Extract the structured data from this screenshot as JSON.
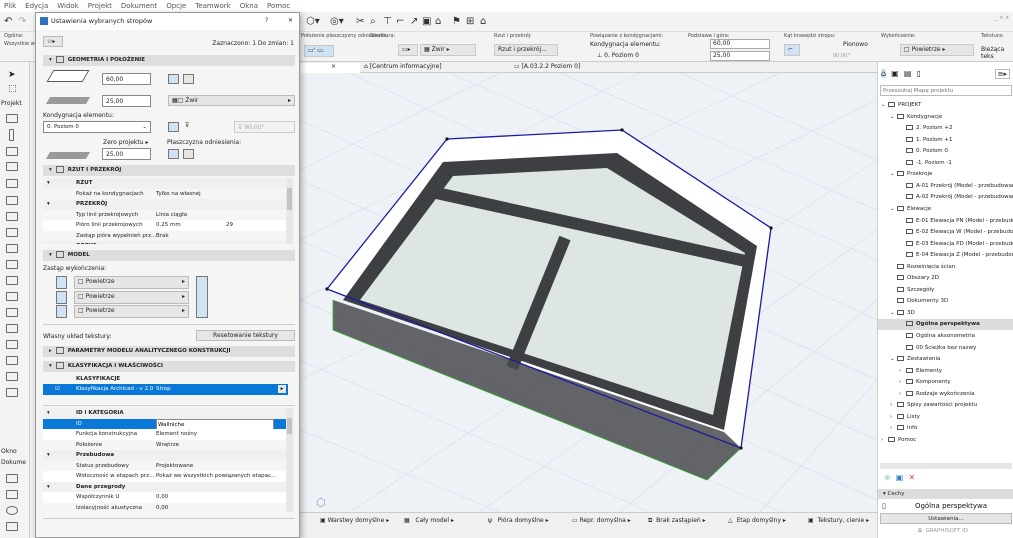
{
  "menu": [
    "Plik",
    "Edycja",
    "Widok",
    "Projekt",
    "Dokument",
    "Opcje",
    "Teamwork",
    "Okna",
    "Pomoc"
  ],
  "infobox": {
    "ogolne": "Ogólne:",
    "wszystkie": "Wszystkie wyb",
    "plaszczyzna_label": "Położenie płaszczyzny odniesienia:",
    "struktura_label": "Struktura:",
    "struktura_value": "Żwir",
    "rzut_label": "Rzut i przekrój:",
    "rzut_value": "Rzut i przekrój...",
    "powiazanie_label": "Powiązanie z kondygnacjami:",
    "kondygnacja_label": "Kondygnacja elementu:",
    "kondygnacja_value": "0. Poziom 0",
    "podstawa_label": "Podstawa i góra:",
    "top_value": "60,00",
    "bottom_value": "25,00",
    "kat_label": "Kąt krawędzi stropu:",
    "pionowo": "Pionowo",
    "angle": "90,00°",
    "wykonczenie_label": "Wykończenie:",
    "wykonczenie_value": "Powietrze",
    "tekstura_label": "Tekstura:",
    "tekstura_value": "Bieżąca teks"
  },
  "tabs": [
    "[Centrum informacyjne]",
    "[A.03.2.2 Poziom 0]"
  ],
  "toolbox": {
    "projekt": "Projekt",
    "okno": "Okno",
    "dokument": "Dokume"
  },
  "statusbar": [
    "Warstwy domyślne",
    "Cały model",
    "Pióra domyślne",
    "Repr. domyślna",
    "Brak zastąpień",
    "Etap domyślny",
    "Tekstury, cienie"
  ],
  "dialog": {
    "title": "Ustawienia wybranych stropów",
    "help": "?",
    "close": "✕",
    "selected": "Zaznaczono: 1 Do zmian: 1",
    "geometry": {
      "header": "GEOMETRIA I POŁOŻENIE",
      "thickness": "60,00",
      "offset": "25,00",
      "structure": "Żwir",
      "story_label": "Kondygnacja elementu:",
      "story": "0. Poziom 0",
      "zero_label": "Zero projektu",
      "zero_value": "25,00",
      "angle": "90,00°",
      "ref_label": "Płaszczyzna odniesienia:"
    },
    "plan": {
      "header": "RZUT I PRZEKRÓJ",
      "rows": [
        {
          "type": "group",
          "k": "RZUT"
        },
        {
          "k": "Pokaż na kondygnacjach",
          "v": "Tylko na własnej"
        },
        {
          "type": "group",
          "k": "PRZEKRÓJ"
        },
        {
          "k": "Typ linii przekrojowych",
          "v": "Linia ciągła"
        },
        {
          "k": "Pióro linii przekrojowych",
          "v": "0.25 mm",
          "n": "29"
        },
        {
          "k": "Zastąp pióra wypełnień prz...",
          "v": "Brak"
        },
        {
          "type": "group",
          "k": "OBRYS"
        }
      ]
    },
    "model": {
      "header": "MODEL",
      "override_label": "Zastąp wykończenia:",
      "surfaces": [
        "Powietrze",
        "Powietrze",
        "Powietrze"
      ],
      "texture_label": "Własny układ tekstury:",
      "reset_button": "Resetowanie tekstury"
    },
    "analytic": {
      "header": "PARAMETRY MODELU ANALITYCZNEGO KONSTRUKCJI"
    },
    "classification": {
      "header": "KLASYFIKACJA I WŁAŚCIWOŚCI",
      "group": "KLASYFIKACJE",
      "system": "Klasyfikacja Archicad - v 2.0",
      "value": "Strop"
    },
    "properties": [
      {
        "type": "group",
        "k": "ID i KATEGORIA"
      },
      {
        "k": "ID",
        "v": "Wallniche",
        "selected": true
      },
      {
        "k": "Funkcja konstrukcyjna",
        "v": "Element nośny"
      },
      {
        "k": "Położenie",
        "v": "Wnętrze"
      },
      {
        "type": "group",
        "k": "Przebudowa"
      },
      {
        "k": "Status przebudowy",
        "v": "Projektowane"
      },
      {
        "k": "Widoczność w etapach prz...",
        "v": "Pokaż we wszystkich powiązanych etapac..."
      },
      {
        "type": "group",
        "k": "Dane przegrody"
      },
      {
        "k": "Współczynnik U",
        "v": "0,00"
      },
      {
        "k": "Izolacyjność akustyczna",
        "v": "0,00"
      }
    ]
  },
  "navigator": {
    "search_placeholder": "Przeszukaj Mapę projektu",
    "tree": [
      {
        "l": 0,
        "t": "PROJEKT",
        "exp": "v"
      },
      {
        "l": 1,
        "t": "Kondygnacje",
        "exp": "v"
      },
      {
        "l": 2,
        "t": "2. Poziom +2"
      },
      {
        "l": 2,
        "t": "1. Poziom +1"
      },
      {
        "l": 2,
        "t": "0. Poziom 0"
      },
      {
        "l": 2,
        "t": "-1. Poziom -1"
      },
      {
        "l": 1,
        "t": "Przekroje",
        "exp": "v"
      },
      {
        "l": 2,
        "t": "A-01 Przekrój (Model - przebudowanie)"
      },
      {
        "l": 2,
        "t": "A-02 Przekrój (Model - przebudowanie)"
      },
      {
        "l": 1,
        "t": "Elewacje",
        "exp": "v"
      },
      {
        "l": 2,
        "t": "E-01 Elewacja PN (Model - przebudowanie)"
      },
      {
        "l": 2,
        "t": "E-02 Elewacja W (Model - przebudowanie)"
      },
      {
        "l": 2,
        "t": "E-03 Elewacja PD (Model - przebudowanie)"
      },
      {
        "l": 2,
        "t": "E-04 Elewacja Z (Model - przebudowanie)"
      },
      {
        "l": 1,
        "t": "Rozwinięcia ścian"
      },
      {
        "l": 1,
        "t": "Obszary 2D"
      },
      {
        "l": 1,
        "t": "Szczegóły"
      },
      {
        "l": 1,
        "t": "Dokumenty 3D"
      },
      {
        "l": 1,
        "t": "3D",
        "exp": "v"
      },
      {
        "l": 2,
        "t": "Ogólna perspektywa",
        "sel": true
      },
      {
        "l": 2,
        "t": "Ogólna aksonometria"
      },
      {
        "l": 2,
        "t": "00 Ścieżka bez nazwy"
      },
      {
        "l": 1,
        "t": "Zestawienia",
        "exp": "v"
      },
      {
        "l": 2,
        "t": "Elementy",
        "exp": ">"
      },
      {
        "l": 2,
        "t": "Komponenty",
        "exp": ">"
      },
      {
        "l": 2,
        "t": "Rodzaje wykończenia",
        "exp": ">"
      },
      {
        "l": 1,
        "t": "Spisy zawartości projektu",
        "exp": ">"
      },
      {
        "l": 1,
        "t": "Listy",
        "exp": ">"
      },
      {
        "l": 1,
        "t": "Info",
        "exp": ">"
      },
      {
        "l": 0,
        "t": "Pomoc",
        "exp": ">"
      }
    ],
    "cechy": "Cechy",
    "view_name": "Ogólna perspektywa",
    "settings_button": "Ustawienia...",
    "graphisoft": "GRAPHISOFT ID"
  },
  "colors": {
    "selection": "#0a78d7",
    "accent_icon": "#cfe3f5",
    "slab_outline": "#1a1aa0",
    "slab_bottom": "#2faa2f",
    "slab_frame": "#3e3f42"
  }
}
